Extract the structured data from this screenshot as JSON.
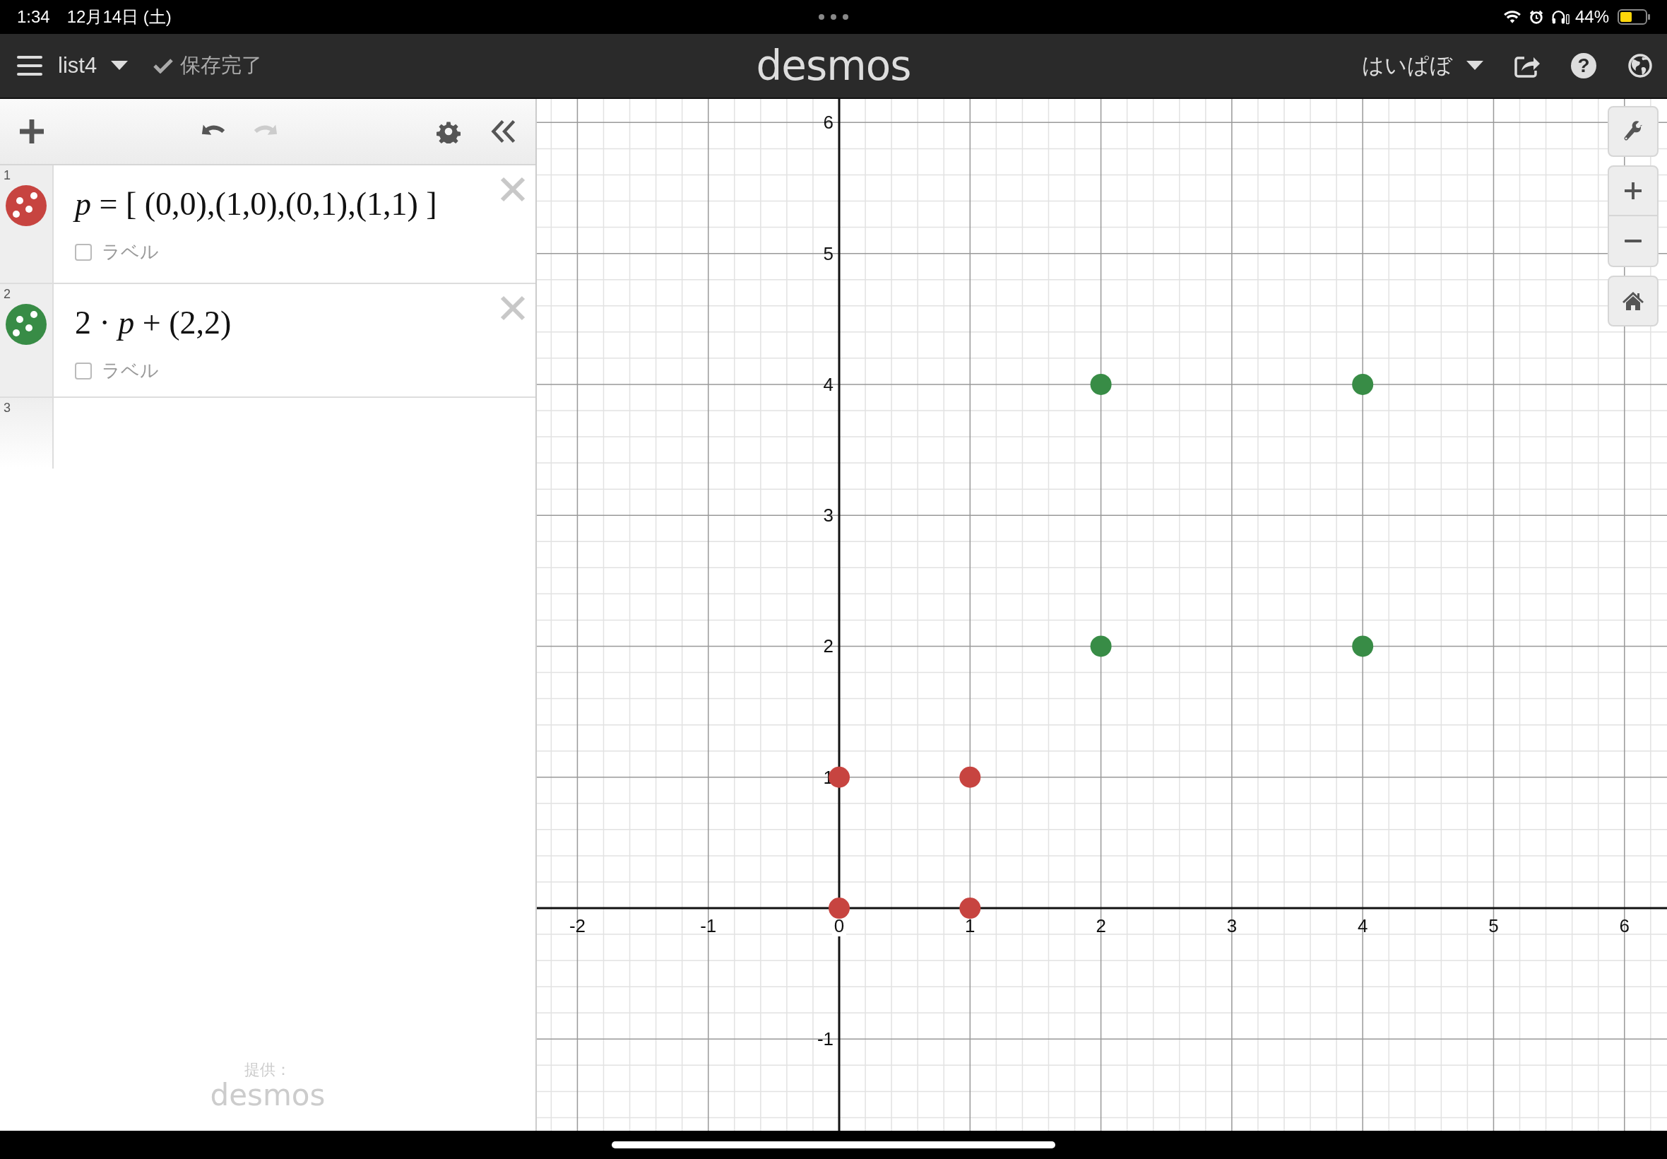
{
  "status_bar": {
    "time": "1:34",
    "date": "12月14日 (土)",
    "battery": "44%"
  },
  "header": {
    "title": "list4",
    "save_status": "保存完了",
    "logo": "desmos",
    "user": "はいぱぼ",
    "help": "?"
  },
  "toolbar": {
    "redo": {
      "disabled": true
    }
  },
  "expressions": [
    {
      "index": "1",
      "color": "#c74440",
      "formula": "*p* = [ (0,0),(1,0),(0,1),(1,1) ]",
      "label": "ラベル",
      "checked": false
    },
    {
      "index": "2",
      "color": "#388c46",
      "formula": "2 · *p* + (2,2)",
      "label": "ラベル",
      "checked": false
    }
  ],
  "new_row": {
    "index": "3"
  },
  "footer": {
    "credit": "提供：",
    "logo": "desmos"
  },
  "graph": {
    "chart_data": {
      "type": "scatter",
      "grid": true,
      "xlim": [
        -2.31,
        6.325
      ],
      "ylim": [
        -1.7,
        6.18
      ],
      "xticks": [
        -2,
        -1,
        0,
        1,
        2,
        3,
        4,
        5,
        6
      ],
      "yticks": [
        -1,
        1,
        2,
        3,
        4,
        5,
        6
      ],
      "series": [
        {
          "color": "#c74440",
          "x": [
            0,
            1,
            0,
            1
          ],
          "values": [
            0,
            0,
            1,
            1
          ]
        },
        {
          "color": "#388c46",
          "x": [
            2,
            4,
            2,
            4
          ],
          "values": [
            2,
            2,
            4,
            4
          ]
        }
      ]
    }
  }
}
